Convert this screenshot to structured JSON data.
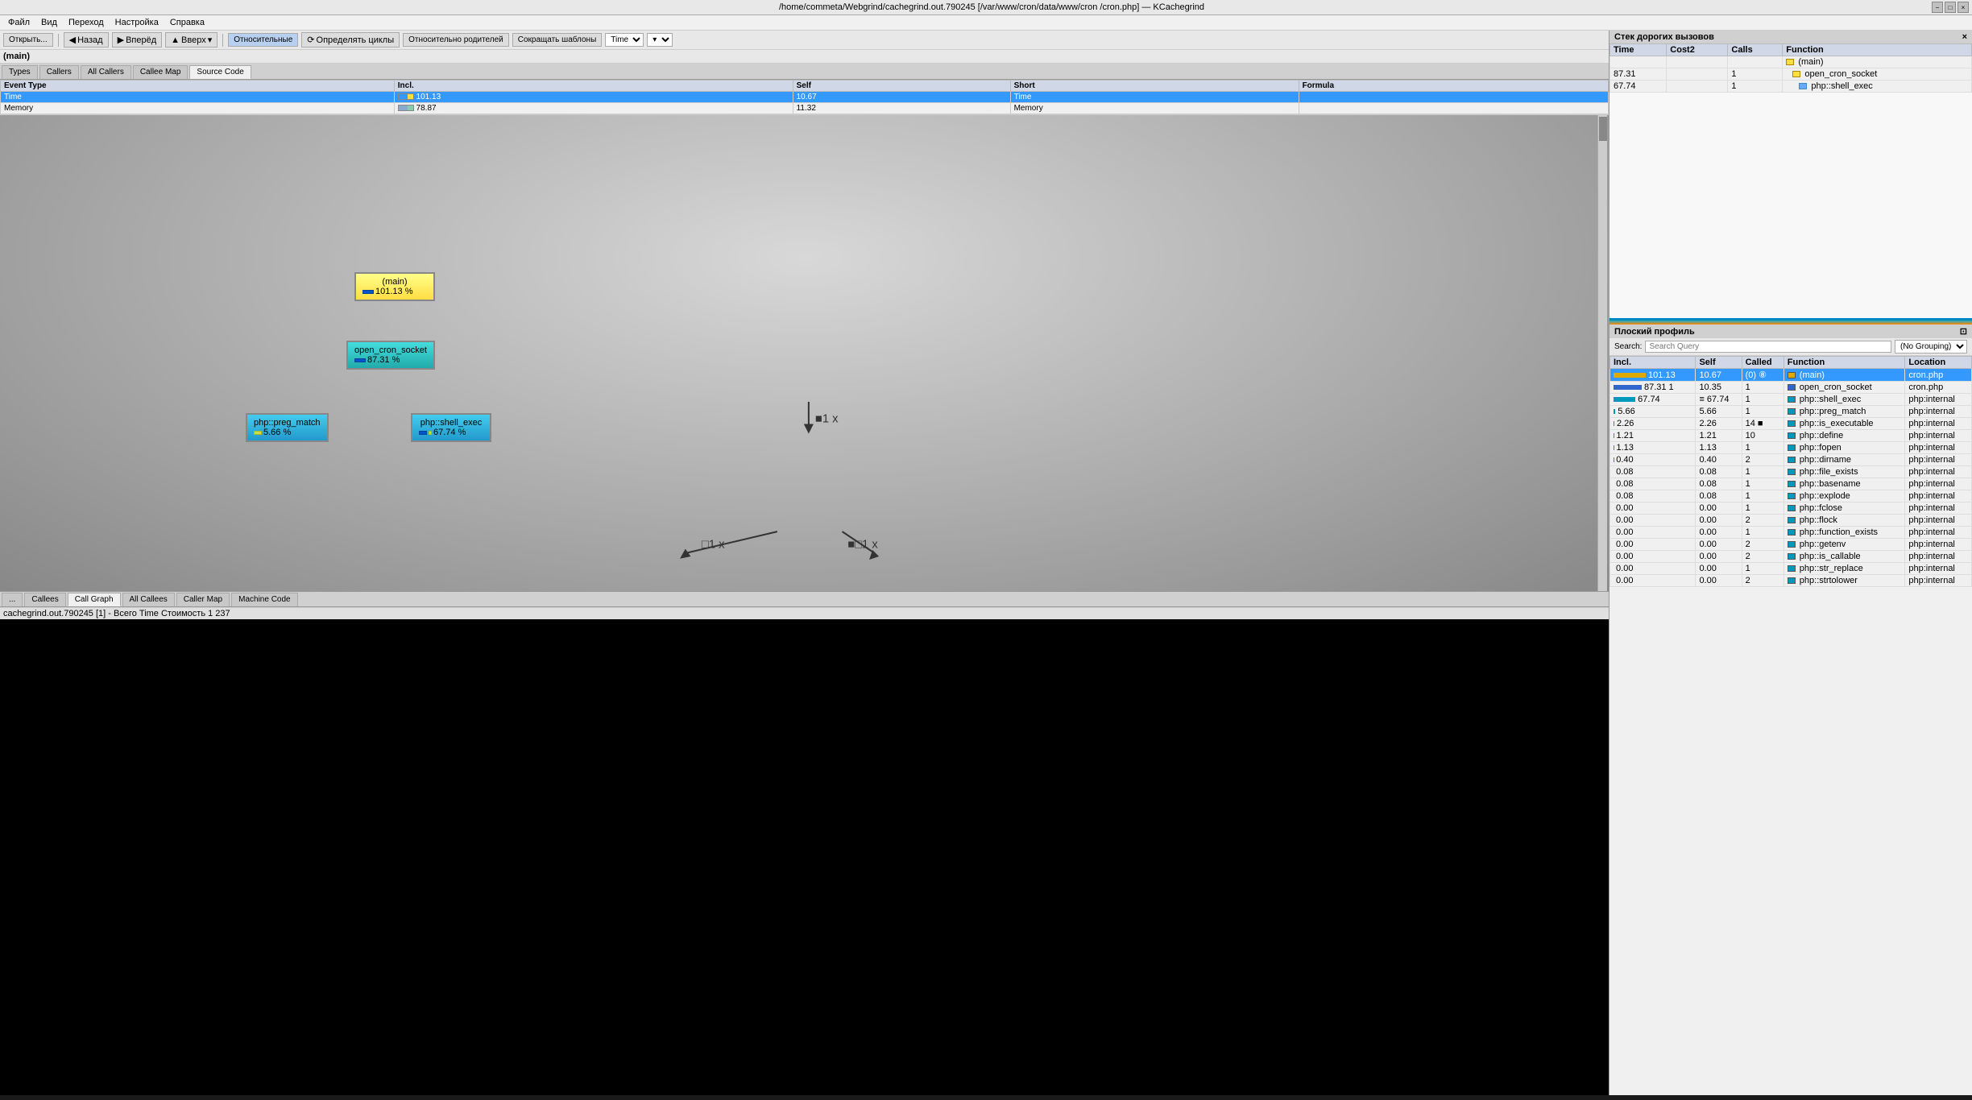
{
  "titleBar": {
    "text": "/home/commeta/Webgrind/cachegrind.out.790245 [/var/www/cron/data/www/cron  /cron.php] — KCachegrind",
    "winControls": [
      "−",
      "□",
      "×"
    ]
  },
  "menuBar": {
    "items": [
      "Файл",
      "Вид",
      "Переход",
      "Настройка",
      "Справка"
    ]
  },
  "toolbar": {
    "backLabel": "Назад",
    "forwardLabel": "Вперёд",
    "upLabel": "Вверх",
    "relativeLabel": "Относительные",
    "cyclesLabel": "Определять циклы",
    "relParentLabel": "Относительно родителей",
    "collapseLabel": "Сокращать шаблоны",
    "timeLabel": "Time",
    "openLabel": "Открыть..."
  },
  "functionLabel": "(main)",
  "tabs": {
    "items": [
      "Types",
      "Callers",
      "All Callers",
      "Callee Map",
      "Source Code"
    ]
  },
  "eventTable": {
    "headers": [
      "Event Type",
      "Incl.",
      "Self",
      "Short",
      "Formula"
    ],
    "rows": [
      {
        "type": "Time",
        "incl": "101.13",
        "self": "10.67",
        "short": "Time",
        "formula": "",
        "selected": true,
        "color1": "#3399ff",
        "color2": "#ffdd44"
      },
      {
        "type": "Memory",
        "incl": "78.87",
        "self": "11.32",
        "short": "Memory",
        "formula": "",
        "selected": false,
        "color1": "#88aacc",
        "color2": "#88ccaa"
      }
    ]
  },
  "callGraph": {
    "nodes": [
      {
        "id": "main",
        "label": "(main)",
        "percent": "101.13 %",
        "barColor": "#ffdd44",
        "type": "main"
      },
      {
        "id": "socket",
        "label": "open_cron_socket",
        "percent": "87.31 %",
        "barColor": "#0055cc",
        "type": "socket"
      },
      {
        "id": "preg",
        "label": "php::preg_match",
        "percent": "5.66 %",
        "barColor": "#aabb44",
        "type": "preg"
      },
      {
        "id": "shell",
        "label": "php::shell_exec",
        "percent": "67.74 %",
        "barColor": "#0055cc",
        "type": "shell"
      }
    ],
    "arrows": [
      {
        "from": "main",
        "to": "socket",
        "label": "■1 x"
      },
      {
        "from": "socket",
        "to": "preg",
        "label": "□1 x"
      },
      {
        "from": "socket",
        "to": "shell",
        "label": "■□1 x"
      }
    ]
  },
  "bottomTabs": {
    "items": [
      "...",
      "Callees",
      "Call Graph",
      "All Callees",
      "Caller Map",
      "Machine Code"
    ]
  },
  "statusBar": {
    "text": "cachegrind.out.790245 [1] - Всего Time Стоимость 1 237"
  },
  "rightPanel": {
    "title": "Стек дорогих вызовов",
    "columns": [
      "Time",
      "Cost2",
      "Calls",
      "Function"
    ],
    "rows": [
      {
        "time": "",
        "cost2": "",
        "calls": "",
        "func": "(main)",
        "bold": true,
        "indent": 0
      },
      {
        "time": "87.31",
        "cost2": "",
        "calls": "1",
        "func": "open_cron_socket",
        "bold": false,
        "indent": 1
      },
      {
        "time": "67.74",
        "cost2": "",
        "calls": "1",
        "func": "php::shell_exec",
        "bold": false,
        "indent": 2
      }
    ]
  },
  "flatProfile": {
    "title": "Плоский профиль",
    "searchPlaceholder": "Search Query",
    "groupingOptions": [
      "(No Grouping)"
    ],
    "groupingSelected": "(No Grouping)",
    "columns": [
      "Incl.",
      "Self",
      "Called",
      "Function",
      "Location"
    ],
    "rows": [
      {
        "incl": "101.13",
        "self": "10.67",
        "called": "(0) ⑧",
        "func": "(main)",
        "location": "cron.php",
        "selected": true,
        "barType": "yellow"
      },
      {
        "incl": "87.31 1",
        "self": "10.35",
        "called": "1",
        "func": "open_cron_socket",
        "location": "cron.php",
        "selected": false,
        "barType": "blue"
      },
      {
        "incl": "67.74",
        "self": "≡ 67.74",
        "called": "1",
        "func": "php::shell_exec",
        "location": "php:internal",
        "selected": false,
        "barType": "cyan"
      },
      {
        "incl": "5.66",
        "self": "5.66",
        "called": "1",
        "func": "php::preg_match",
        "location": "php:internal",
        "selected": false,
        "barType": "cyan"
      },
      {
        "incl": "2.26",
        "self": "2.26",
        "called": "14 ■",
        "func": "php::is_executable",
        "location": "php:internal",
        "selected": false,
        "barType": "cyan"
      },
      {
        "incl": "1.21",
        "self": "1.21",
        "called": "10",
        "func": "php::define",
        "location": "php:internal",
        "selected": false,
        "barType": "cyan"
      },
      {
        "incl": "1.13",
        "self": "1.13",
        "called": "1",
        "func": "php::fopen",
        "location": "php:internal",
        "selected": false,
        "barType": "cyan"
      },
      {
        "incl": "0.40",
        "self": "0.40",
        "called": "2",
        "func": "php::dirname",
        "location": "php:internal",
        "selected": false,
        "barType": "cyan"
      },
      {
        "incl": "0.08",
        "self": "0.08",
        "called": "1",
        "func": "php::file_exists",
        "location": "php:internal",
        "selected": false,
        "barType": "cyan"
      },
      {
        "incl": "0.08",
        "self": "0.08",
        "called": "1",
        "func": "php::basename",
        "location": "php:internal",
        "selected": false,
        "barType": "cyan"
      },
      {
        "incl": "0.08",
        "self": "0.08",
        "called": "1",
        "func": "php::explode",
        "location": "php:internal",
        "selected": false,
        "barType": "cyan"
      },
      {
        "incl": "0.00",
        "self": "0.00",
        "called": "1",
        "func": "php::fclose",
        "location": "php:internal",
        "selected": false,
        "barType": "cyan"
      },
      {
        "incl": "0.00",
        "self": "0.00",
        "called": "2",
        "func": "php::flock",
        "location": "php:internal",
        "selected": false,
        "barType": "cyan"
      },
      {
        "incl": "0.00",
        "self": "0.00",
        "called": "1",
        "func": "php::function_exists",
        "location": "php:internal",
        "selected": false,
        "barType": "cyan"
      },
      {
        "incl": "0.00",
        "self": "0.00",
        "called": "2",
        "func": "php::getenv",
        "location": "php:internal",
        "selected": false,
        "barType": "cyan"
      },
      {
        "incl": "0.00",
        "self": "0.00",
        "called": "2",
        "func": "php::is_callable",
        "location": "php:internal",
        "selected": false,
        "barType": "cyan"
      },
      {
        "incl": "0.00",
        "self": "0.00",
        "called": "1",
        "func": "php::str_replace",
        "location": "php:internal",
        "selected": false,
        "barType": "cyan"
      },
      {
        "incl": "0.00",
        "self": "0.00",
        "called": "2",
        "func": "php::strtolower",
        "location": "php:internal",
        "selected": false,
        "barType": "cyan"
      }
    ]
  }
}
